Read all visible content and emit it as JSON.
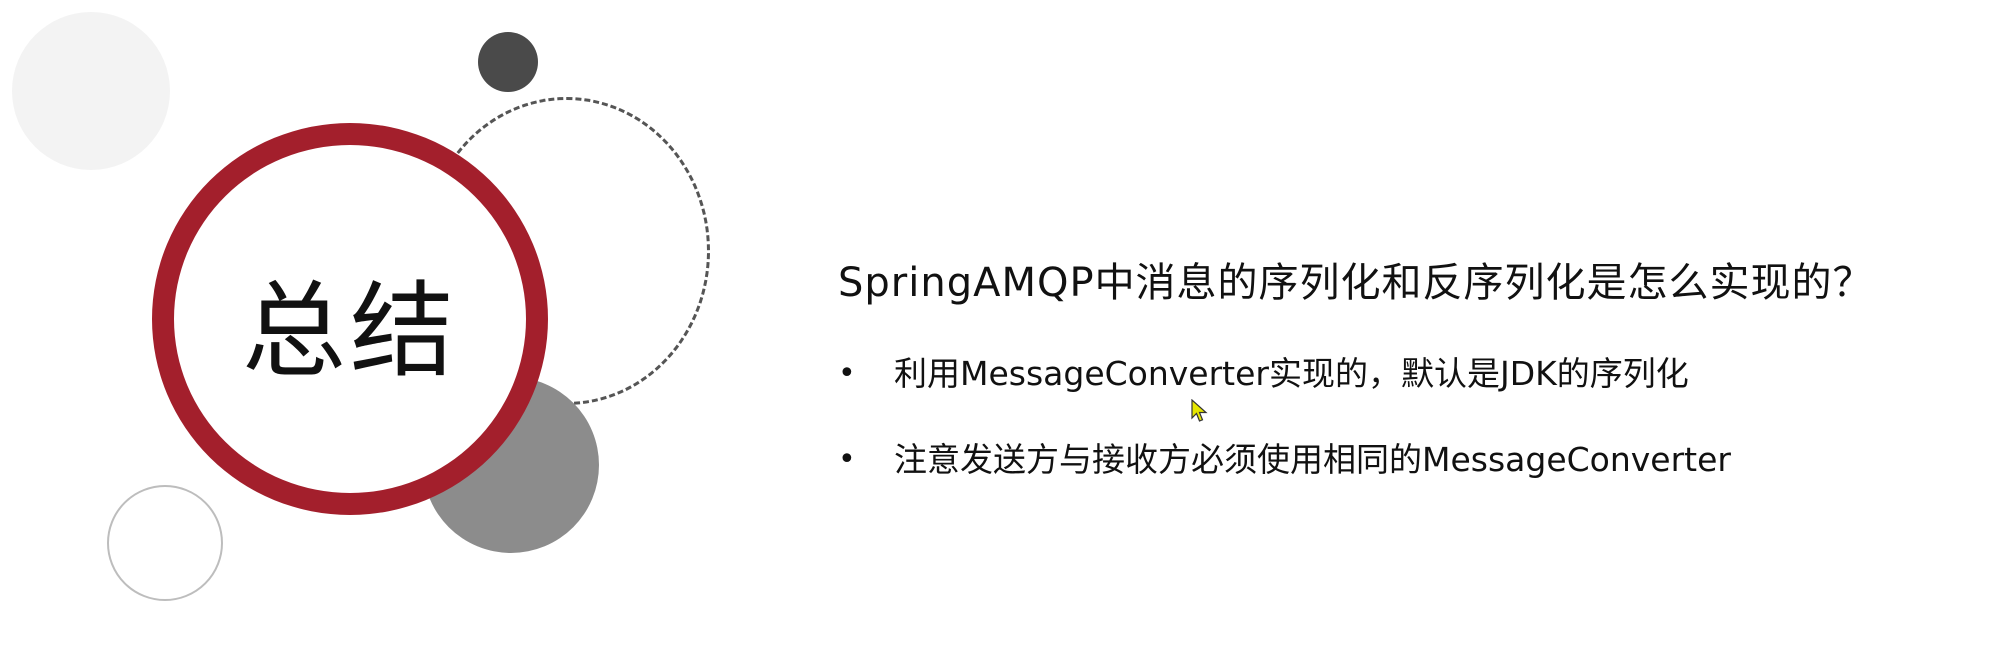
{
  "slide": {
    "heading": "总结",
    "question": "SpringAMQP中消息的序列化和反序列化是怎么实现的？",
    "bullets": [
      {
        "marker": "•",
        "text": "利用MessageConverter实现的，默认是JDK的序列化"
      },
      {
        "marker": "•",
        "text": "注意发送方与接收方必须使用相同的MessageConverter"
      }
    ]
  },
  "colors": {
    "ring": "#a31f2c",
    "dark_dot": "#4a4a4a",
    "gray_circle": "#8c8c8c",
    "light_circle": "#f3f3f3",
    "outline_circle": "#bdbdbd",
    "cursor": "#e5e600"
  },
  "icons": {
    "cursor": "mouse-pointer-icon"
  }
}
